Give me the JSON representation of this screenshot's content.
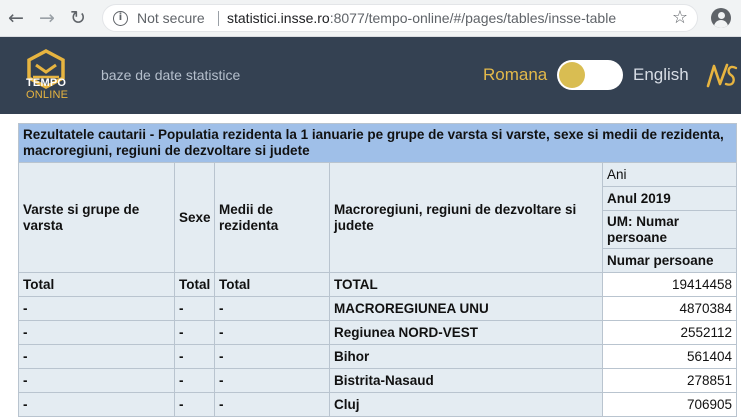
{
  "browser": {
    "security_label": "Not secure",
    "url_host": "statistici.insse.ro",
    "url_rest": ":8077/tempo-online/#/pages/tables/insse-table"
  },
  "header": {
    "logo_line1": "TEMPO",
    "logo_line2": "ONLINE",
    "tagline": "baze de date statistice",
    "lang_ro": "Romana",
    "lang_en": "English",
    "toggle_on": true,
    "brand_color": "#344152",
    "accent_color": "#e7b440"
  },
  "results": {
    "title": "Rezultatele cautarii - Populatia rezidenta la 1 ianuarie pe grupe de varsta si varste, sexe si medii de rezidenta, macroregiuni, regiuni de dezvoltare si judete",
    "columns": {
      "age": "Varste si grupe de varsta",
      "sex": "Sexe",
      "medium": "Medii de rezidenta",
      "region": "Macroregiuni, regiuni de dezvoltare si judete",
      "years_label": "Ani",
      "year": "Anul 2019",
      "unit": "UM: Numar persoane",
      "value": "Numar persoane"
    },
    "rows": [
      {
        "age": "Total",
        "sex": "Total",
        "medium": "Total",
        "region": "TOTAL",
        "value": "19414458"
      },
      {
        "age": "-",
        "sex": "-",
        "medium": "-",
        "region": "MACROREGIUNEA UNU",
        "value": "4870384"
      },
      {
        "age": "-",
        "sex": "-",
        "medium": "-",
        "region": "Regiunea NORD-VEST",
        "value": "2552112"
      },
      {
        "age": "-",
        "sex": "-",
        "medium": "-",
        "region": "Bihor",
        "value": "561404"
      },
      {
        "age": "-",
        "sex": "-",
        "medium": "-",
        "region": "Bistrita-Nasaud",
        "value": "278851"
      },
      {
        "age": "-",
        "sex": "-",
        "medium": "-",
        "region": "Cluj",
        "value": "706905"
      }
    ]
  }
}
